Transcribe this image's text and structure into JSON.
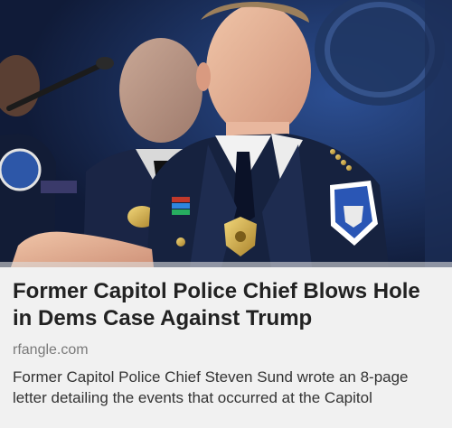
{
  "article": {
    "headline": "Former Capitol Police Chief Blows Hole in Dems Case Against Trump",
    "source": "rfangle.com",
    "description": "Former Capitol Police Chief Steven Sund wrote an 8-page letter detailing the events that occurred at the Capitol"
  },
  "colors": {
    "background": "#f1f1f1",
    "headline": "#222222",
    "source": "#7a7a7a",
    "description": "#333333",
    "uniform": "#16223f"
  }
}
